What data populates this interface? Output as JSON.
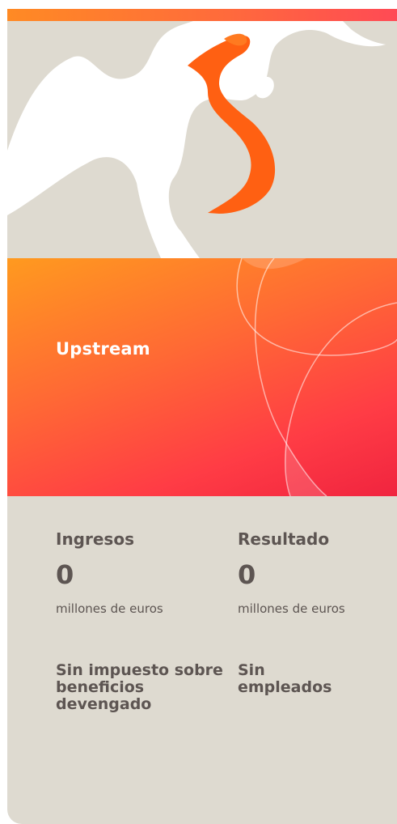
{
  "section": {
    "title": "Upstream"
  },
  "colors": {
    "accent_orange": "#ff6a1a",
    "hero_gradient_start": "#ff9a1f",
    "hero_gradient_end": "#f0243f",
    "card_background": "#dedad0",
    "text": "#5d5552"
  },
  "illustration": {
    "icon": "decorative-map-shape"
  },
  "stats": {
    "revenue": {
      "label": "Ingresos",
      "value": "0",
      "unit": "millones de euros"
    },
    "result": {
      "label": "Resultado",
      "value": "0",
      "unit": "millones de euros"
    },
    "tax_note": "Sin impuesto sobre beneficios devengado",
    "employees_note": "Sin empleados"
  }
}
